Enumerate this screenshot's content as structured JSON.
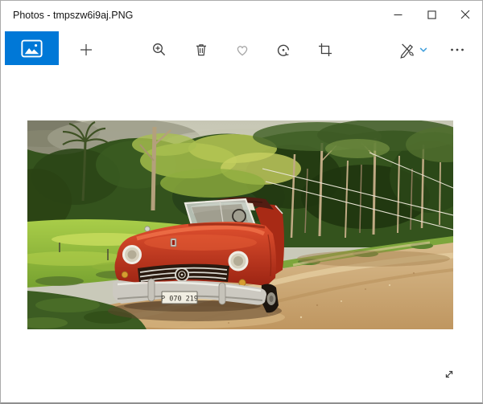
{
  "window": {
    "title": "Photos - tmpszw6i9aj.PNG",
    "controls": [
      "minimize",
      "maximize",
      "close"
    ]
  },
  "toolbar": {
    "buttons": [
      {
        "name": "see-all-photos",
        "icon": "photos-icon"
      },
      {
        "name": "add",
        "icon": "add-icon"
      },
      {
        "name": "zoom-in",
        "icon": "zoom-in-icon"
      },
      {
        "name": "delete",
        "icon": "delete-icon"
      },
      {
        "name": "favorite",
        "icon": "heart-icon"
      },
      {
        "name": "rotate",
        "icon": "rotate-icon"
      },
      {
        "name": "crop",
        "icon": "crop-icon"
      },
      {
        "name": "edit-create",
        "icon": "edit-create-icon",
        "dropdown_icon": "chevron-down-icon"
      },
      {
        "name": "see-more",
        "icon": "ellipsis-icon"
      }
    ]
  },
  "viewer": {
    "photo_description": "Red vintage convertible parked on a dirt road beside a bright green meadow with tropical trees and palm under a cloudy sky",
    "license_plate": "P 070 219",
    "fullscreen_icon": "fullscreen-icon"
  },
  "colors": {
    "accent_blue": "#0078d7",
    "dropdown_chevron_blue": "#42a0dc",
    "icon_gray": "#3f3f3f",
    "heart_gray": "#a6a6a6",
    "window_border": "#ababab",
    "titlebar_bg": "#ffffff",
    "car_red": "#c23a20",
    "road_tan": "#c9a36e",
    "grass_green": "#93bd3c"
  }
}
